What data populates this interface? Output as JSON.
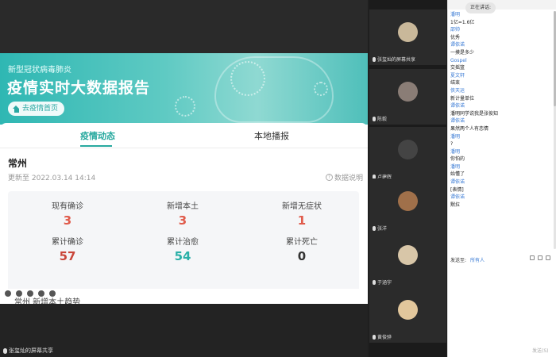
{
  "banner": {
    "subtitle": "新型冠状病毒肺炎",
    "title": "疫情实时大数据报告",
    "home_button": "去疫情首页"
  },
  "tabs": [
    "疫情动态",
    "本地播报"
  ],
  "city": "常州",
  "updated": "更新至 2022.03.14 14:14",
  "explain": "数据说明",
  "stats": [
    {
      "label": "现有确诊",
      "value": "3",
      "color": "#e05b4b"
    },
    {
      "label": "新增本土",
      "value": "3",
      "color": "#e05b4b"
    },
    {
      "label": "新增无症状",
      "value": "1",
      "color": "#e05b4b"
    },
    {
      "label": "累计确诊",
      "value": "57",
      "color": "#c9463a"
    },
    {
      "label": "累计治愈",
      "value": "54",
      "color": "#2ab0a8"
    },
    {
      "label": "累计死亡",
      "value": "0",
      "color": "#333333"
    }
  ],
  "trend_title": "常州 新增本土趋势",
  "share_label": "张玺灿的屏幕共享",
  "participants": [
    {
      "name": "张玺灿的屏幕共享",
      "avatar_color": "#c9b89a"
    },
    {
      "name": "陈毅",
      "avatar_color": "#8a7d76"
    },
    {
      "name": "卢建辉",
      "avatar_color": "#444444"
    },
    {
      "name": "张洋",
      "avatar_color": "#a0704a"
    },
    {
      "name": "于涵宇",
      "avatar_color": "#d8c6a8"
    },
    {
      "name": "黄俊骅",
      "avatar_color": "#e2c79c"
    }
  ],
  "chat": {
    "speaking": "正在讲话:",
    "messages": [
      {
        "type": "name",
        "text": "潘明"
      },
      {
        "type": "text",
        "text": "1亿=1.6亿"
      },
      {
        "type": "name",
        "text": "邵帅"
      },
      {
        "type": "text",
        "text": "优秀"
      },
      {
        "type": "name",
        "text": "谭依诺"
      },
      {
        "type": "text",
        "text": "一摸是多少"
      },
      {
        "type": "name",
        "text": "Gospel"
      },
      {
        "type": "text",
        "text": "交摇篮"
      },
      {
        "type": "name",
        "text": "夏文轩"
      },
      {
        "type": "text",
        "text": "结束"
      },
      {
        "type": "name",
        "text": "侠天运"
      },
      {
        "type": "text",
        "text": "新计量单位"
      },
      {
        "type": "name",
        "text": "谭依诺"
      },
      {
        "type": "text",
        "text": "潘明同学说我是张俊知"
      },
      {
        "type": "name",
        "text": "谭依诺"
      },
      {
        "type": "text",
        "text": "果然两个人有恋情"
      },
      {
        "type": "name",
        "text": "潘明"
      },
      {
        "type": "text",
        "text": "?"
      },
      {
        "type": "name",
        "text": "潘明"
      },
      {
        "type": "text",
        "text": "你怕的"
      },
      {
        "type": "name",
        "text": "潘明"
      },
      {
        "type": "text",
        "text": "始懂了"
      },
      {
        "type": "name",
        "text": "谭依诺"
      },
      {
        "type": "text",
        "text": "[表情]"
      },
      {
        "type": "name",
        "text": "谭依诺"
      },
      {
        "type": "text",
        "text": "黙拉"
      }
    ],
    "send_to_label": "发送至:",
    "send_to_value": "所有人",
    "send_button": "发送(S)"
  }
}
